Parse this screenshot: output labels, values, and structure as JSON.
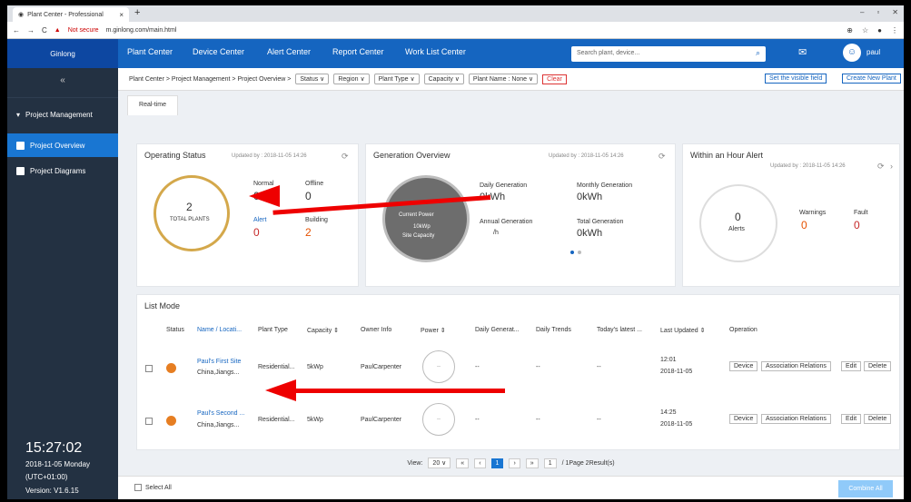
{
  "browser": {
    "tab_title": "Plant Center - Professional",
    "tab_close": "×",
    "new_tab": "+",
    "win_controls": [
      "–",
      "▫",
      "✕"
    ],
    "security": "Not secure",
    "url": "m.ginlong.com/main.html",
    "nav_back": "←",
    "nav_forward": "→",
    "reload": "C"
  },
  "nav": {
    "logo": "Ginlong",
    "items": [
      "Plant Center",
      "Device Center",
      "Alert Center",
      "Report Center",
      "Work List Center"
    ],
    "search_placeholder": "Search plant, device...",
    "user": "paul"
  },
  "sidebar": {
    "collapse": "«",
    "items": [
      "Project Management",
      "Project Overview",
      "Project Diagrams"
    ],
    "time": "15:27:02",
    "date": "2018-11-05  Monday",
    "timezone": "(UTC+01:00)",
    "version": "Version:  V1.6.15"
  },
  "toolbar": {
    "breadcrumb": "Plant Center > Project Management > Project Overview >",
    "filters": [
      "Status ∨",
      "Region ∨",
      "Plant Type ∨",
      "Capacity ∨",
      "Plant Name : None ∨"
    ],
    "clear": "Clear",
    "set_fields": "Set the visible field",
    "create_plant": "Create New Plant"
  },
  "realtime_tab": "Real-time",
  "operating": {
    "title": "Operating Status",
    "updated": "Updated by : 2018-11-05 14:26",
    "total": "2",
    "total_label": "TOTAL PLANTS",
    "normal_label": "Normal",
    "normal": "0",
    "offline_label": "Offline",
    "offline": "0",
    "alert_label": "Alert",
    "alert": "0",
    "building_label": "Building",
    "building": "2"
  },
  "generation": {
    "title": "Generation Overview",
    "updated": "Updated by : 2018-11-05 14:26",
    "current_power": "Current Power",
    "site_capacity_value": "10kWp",
    "site_capacity": "Site Capacity",
    "daily_label": "Daily Generation",
    "daily": "0kWh",
    "monthly_label": "Monthly Generation",
    "monthly": "0kWh",
    "annual_label": "Annual Generation",
    "annual": "/h",
    "total_label": "Total Generation",
    "total": "0kWh"
  },
  "alert_card": {
    "title": "Within an Hour Alert",
    "updated": "Updated by : 2018-11-05 14:26",
    "alerts": "0",
    "alerts_label": "Alerts",
    "warnings_label": "Warnings",
    "warnings": "0",
    "fault_label": "Fault",
    "fault": "0"
  },
  "list": {
    "title": "List Mode",
    "headers": [
      "Status",
      "Name / Locati...",
      "Plant Type",
      "Capacity ⇕",
      "Owner Info",
      "Power ⇕",
      "Daily Generat...",
      "Daily Trends",
      "Today's latest ...",
      "Last Updated ⇕",
      "Operation"
    ],
    "rows": [
      {
        "name": "Paul's First Site",
        "location": "China,Jiangs...",
        "type": "Residential...",
        "capacity": "5kWp",
        "owner": "PaulCarpenter",
        "power": "--",
        "daily": "--",
        "trends": "--",
        "latest": "--",
        "time": "12:01",
        "date": "2018-11-05"
      },
      {
        "name": "Paul's Second ...",
        "location": "China,Jiangs...",
        "type": "Residential...",
        "capacity": "5kWp",
        "owner": "PaulCarpenter",
        "power": "--",
        "daily": "--",
        "trends": "--",
        "latest": "--",
        "time": "14:25",
        "date": "2018-11-05"
      }
    ],
    "ops": [
      "Device",
      "Association Relations",
      "Edit",
      "Delete"
    ]
  },
  "pager": {
    "view_label": "View:",
    "view": "20  ∨",
    "first": "«",
    "prev": "‹",
    "page": "1",
    "next": "›",
    "last": "»",
    "goto": "1",
    "summary": "/ 1Page 2Result(s)"
  },
  "footer": {
    "select_all": "Select All",
    "combine": "Combine All"
  }
}
